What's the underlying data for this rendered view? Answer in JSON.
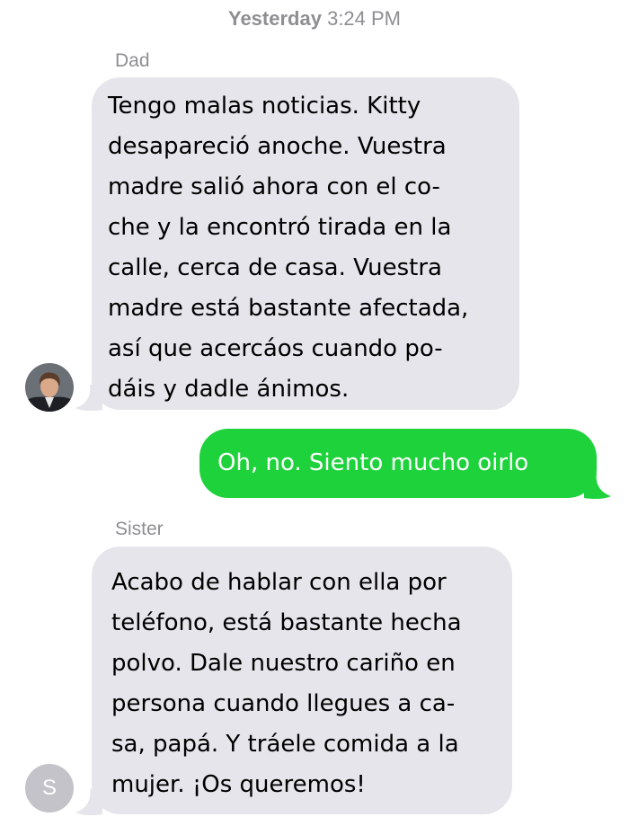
{
  "header": {
    "day": "Yesterday",
    "time": "3:24 PM"
  },
  "messages": [
    {
      "sender": "Dad",
      "direction": "incoming",
      "avatar_icon": "person-photo-icon",
      "lines": [
        "Tengo malas noticias. Kitty",
        "desapareció anoche. Vuestra",
        "madre salió ahora con el co-",
        "che y la encontró tirada en la",
        "calle, cerca de casa. Vuestra",
        "madre está bastante afectada,",
        "así que acercáos cuando po-",
        "dáis y dadle ánimos."
      ]
    },
    {
      "direction": "outgoing",
      "lines": [
        "Oh, no. Siento mucho oirlo"
      ]
    },
    {
      "sender": "Sister",
      "direction": "incoming",
      "avatar_letter": "S",
      "lines": [
        "Acabo de hablar con ella por",
        "teléfono, está bastante hecha",
        "polvo. Dale nuestro cariño en",
        "persona cuando llegues a ca-",
        "sa, papá. Y tráele comida a la",
        "mujer. ¡Os queremos!"
      ]
    }
  ],
  "colors": {
    "incoming_bubble": "#e6e5eb",
    "outgoing_bubble": "#1dd23a",
    "meta_text": "#8e8e93"
  }
}
